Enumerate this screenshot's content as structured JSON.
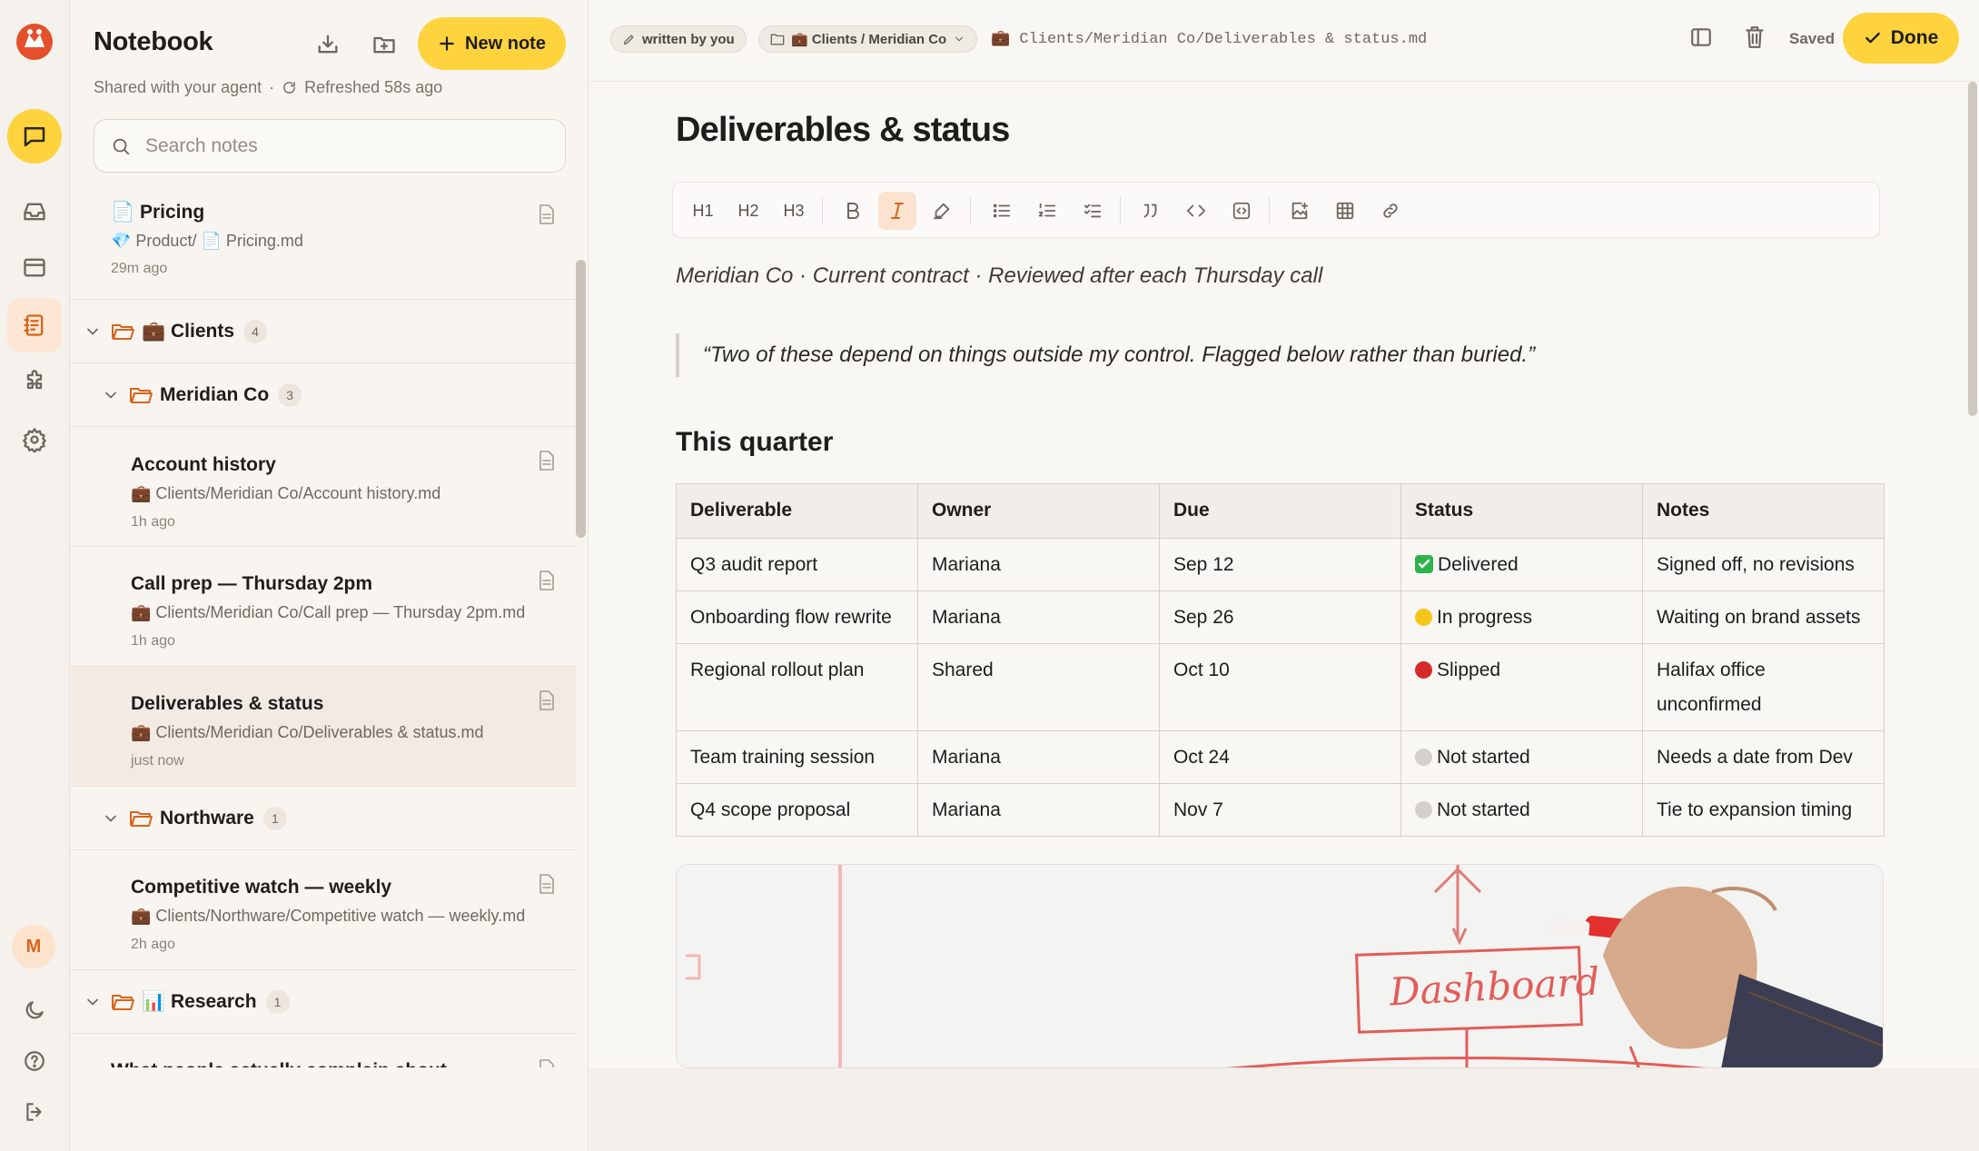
{
  "notebook": {
    "title": "Notebook",
    "new_note_label": "New note",
    "shared_text": "Shared with your agent",
    "separator": "·",
    "refreshed_text": "Refreshed 58s ago",
    "search_placeholder": "Search notes"
  },
  "rail": {
    "avatar_initial": "M"
  },
  "notes": {
    "pricing": {
      "title": "📄 Pricing",
      "path": "💎 Product/ 📄 Pricing.md",
      "age": "29m ago"
    },
    "account_history": {
      "title": "Account history",
      "path": "💼 Clients/Meridian Co/Account history.md",
      "age": "1h ago"
    },
    "call_prep": {
      "title": "Call prep — Thursday 2pm",
      "path": "💼 Clients/Meridian Co/Call prep — Thursday 2pm.md",
      "age": "1h ago"
    },
    "deliverables": {
      "title": "Deliverables & status",
      "path": "💼 Clients/Meridian Co/Deliverables & status.md",
      "age": "just now"
    },
    "competitive": {
      "title": "Competitive watch — weekly",
      "path": "💼 Clients/Northware/Competitive watch — weekly.md",
      "age": "2h ago"
    },
    "complain": {
      "title": "What people actually complain about"
    }
  },
  "folders": {
    "clients": {
      "label": "💼 Clients",
      "count": "4"
    },
    "meridian": {
      "label": "Meridian Co",
      "count": "3"
    },
    "northware": {
      "label": "Northware",
      "count": "1"
    },
    "research": {
      "label": "📊 Research",
      "count": "1"
    }
  },
  "editor": {
    "author_pill": "written by you",
    "folder_pill": "💼 Clients / Meridian Co",
    "path": "💼 Clients/Meridian Co/Deliverables & status.md",
    "saved": "Saved",
    "done_label": "Done",
    "title": "Deliverables & status",
    "meta_line": "Meridian Co · Current contract · Reviewed after each Thursday call",
    "quote": "“Two of these depend on things outside my control. Flagged below rather than buried.”",
    "section_heading": "This quarter",
    "toolbar": {
      "h1": "H1",
      "h2": "H2",
      "h3": "H3"
    }
  },
  "table": {
    "headers": [
      "Deliverable",
      "Owner",
      "Due",
      "Status",
      "Notes"
    ],
    "rows": [
      {
        "deliverable": "Q3 audit report",
        "owner": "Mariana",
        "due": "Sep 12",
        "status": "Delivered",
        "notes": "Signed off, no revisions"
      },
      {
        "deliverable": "Onboarding flow rewrite",
        "owner": "Mariana",
        "due": "Sep 26",
        "status": "In progress",
        "notes": "Waiting on brand assets"
      },
      {
        "deliverable": "Regional rollout plan",
        "owner": "Shared",
        "due": "Oct 10",
        "status": "Slipped",
        "notes": "Halifax office unconfirmed"
      },
      {
        "deliverable": "Team training session",
        "owner": "Mariana",
        "due": "Oct 24",
        "status": "Not started",
        "notes": "Needs a date from Dev"
      },
      {
        "deliverable": "Q4 scope proposal",
        "owner": "Mariana",
        "due": "Nov 7",
        "status": "Not started",
        "notes": "Tie to expansion timing"
      }
    ]
  },
  "whiteboard": {
    "label": "Dashboard"
  },
  "colors": {
    "accent_yellow": "#ffd33d",
    "accent_orange": "#d9641c",
    "status_green": "#2db34a",
    "status_yellow": "#f5c518",
    "status_red": "#d62a2a",
    "status_grey": "#d4d0cb"
  }
}
